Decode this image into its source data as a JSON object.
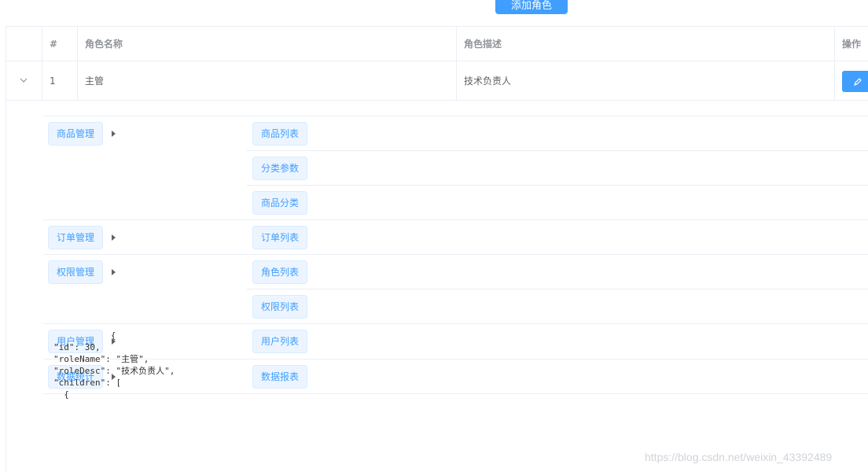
{
  "toolbar": {
    "add_role_label": "添加角色"
  },
  "table": {
    "headers": {
      "index": "#",
      "role_name": "角色名称",
      "role_desc": "角色描述",
      "actions": "操作"
    },
    "row": {
      "index": "1",
      "role_name": "主管",
      "role_desc": "技术负责人"
    }
  },
  "permissions": {
    "level1": [
      {
        "label": "商品管理",
        "children": [
          "商品列表",
          "分类参数",
          "商品分类"
        ]
      },
      {
        "label": "订单管理",
        "children": [
          "订单列表"
        ]
      },
      {
        "label": "权限管理",
        "children": [
          "角色列表",
          "权限列表"
        ]
      },
      {
        "label": "用户管理",
        "children": [
          "用户列表"
        ]
      },
      {
        "label": "数据统计",
        "children": [
          "数据报表"
        ]
      }
    ]
  },
  "json_dump": {
    "line1": "           {",
    "line2": "\"id\": 30,",
    "line3": "\"roleName\": \"主管\",",
    "line4": "\"roleDesc\": \"技术负责人\",",
    "line5": "\"children\": [",
    "line6": "  {"
  },
  "watermark": "https://blog.csdn.net/weixin_43392489",
  "colors": {
    "primary": "#409eff",
    "tag_bg": "#ecf5ff",
    "border": "#ebeef5"
  }
}
